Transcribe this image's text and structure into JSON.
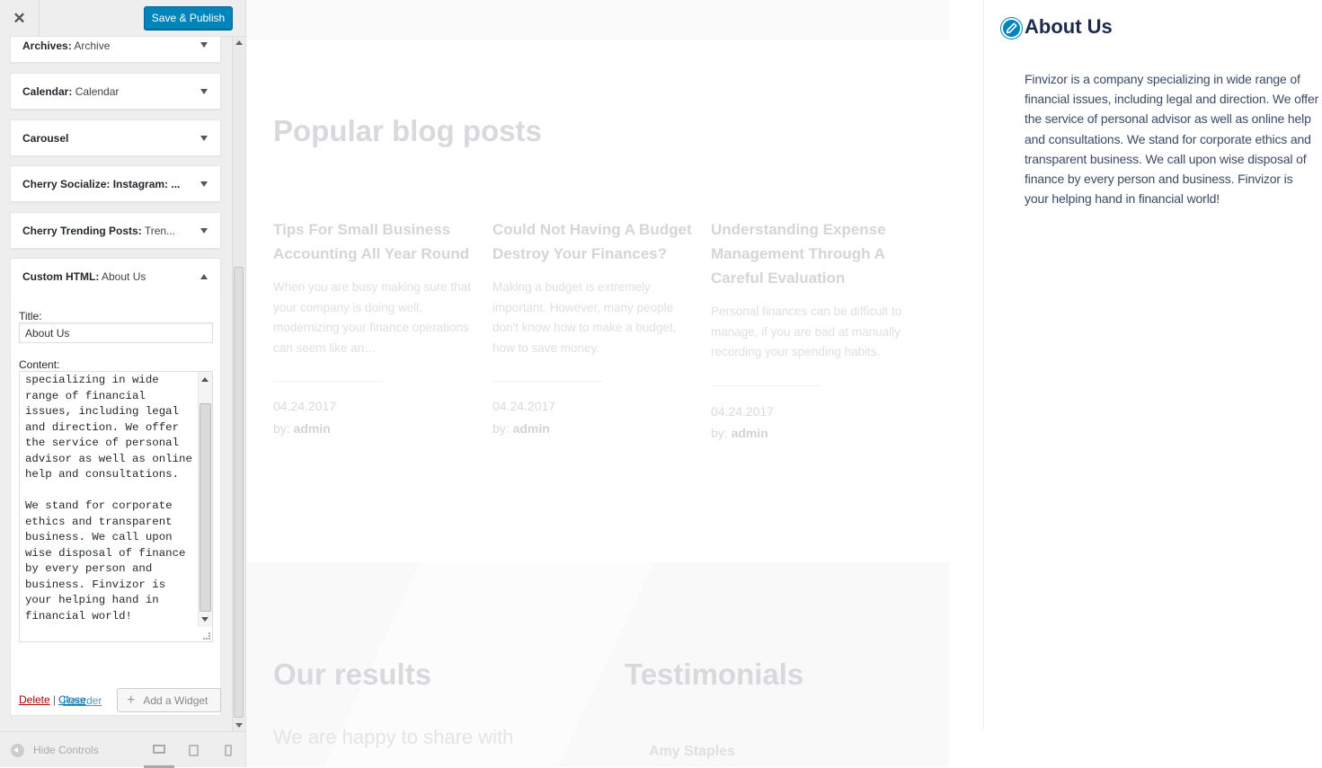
{
  "header": {
    "close_glyph": "✕",
    "publish_label": "Save & Publish"
  },
  "widgets": [
    {
      "name": "Archives:",
      "sub": "Archive",
      "expanded": false
    },
    {
      "name": "Calendar:",
      "sub": "Calendar",
      "expanded": false
    },
    {
      "name": "Carousel",
      "sub": "",
      "expanded": false
    },
    {
      "name": "Cherry Socialize: Instagram: ...",
      "sub": "",
      "expanded": false
    },
    {
      "name": "Cherry Trending Posts:",
      "sub": "Tren...",
      "expanded": false
    },
    {
      "name": "Custom HTML:",
      "sub": "About Us",
      "expanded": true
    }
  ],
  "custom_html": {
    "title_label": "Title:",
    "title_value": "About Us",
    "content_label": "Content:",
    "content_value": "specializing in wide\nrange of financial\nissues, including legal\nand direction. We offer\nthe service of personal\nadvisor as well as online\nhelp and consultations.\n\nWe stand for corporate\nethics and transparent\nbusiness. We call upon\nwise disposal of finance\nby every person and\nbusiness. Finvizor is\nyour helping hand in\nfinancial world!",
    "delete_label": "Delete",
    "separator": "|",
    "close_label": "Close"
  },
  "actions": {
    "reorder_label": "Reorder",
    "add_widget_label": "Add a Widget",
    "plus_glyph": "+"
  },
  "footer": {
    "hide_controls_label": "Hide Controls",
    "devices": [
      "desktop-icon",
      "tablet-icon",
      "mobile-icon"
    ]
  },
  "preview": {
    "popular_heading": "Popular blog posts",
    "posts": [
      {
        "title": "Tips For Small Business Accounting All Year Round",
        "excerpt": "When you are busy making sure that your company is doing well, modernizing your finance operations can seem like an…",
        "date": "04.24.2017",
        "by": "by:",
        "author": "admin"
      },
      {
        "title": "Could Not Having A Budget Destroy Your Finances?",
        "excerpt": "Making a budget is extremely important. However, many people don't know how to make a budget, how to save money.",
        "date": "04.24.2017",
        "by": "by:",
        "author": "admin"
      },
      {
        "title": "Understanding Expense Management Through A Careful Evaluation",
        "excerpt": "Personal finances can be difficult to manage, if you are bad at manually recording your spending habits.",
        "date": "04.24.2017",
        "by": "by:",
        "author": "admin"
      }
    ],
    "results_heading": "Our results",
    "results_text": "We are happy to share with",
    "testimonials_heading": "Testimonials",
    "testimonial_name": "Amy Staples"
  },
  "about_widget": {
    "title": "About Us",
    "text": "Finvizor is a company specializing in wide range of financial issues, including legal and direction. We offer the service of personal advisor as well as online help and consultations. We stand for corporate ethics and transparent business. We call upon wise disposal of finance by every person and business. Finvizor is your helping hand in financial world!"
  },
  "colors": {
    "primary": "#0085ba",
    "delete": "#a00000",
    "link": "#0073aa",
    "about_title": "#1d2b4a"
  }
}
